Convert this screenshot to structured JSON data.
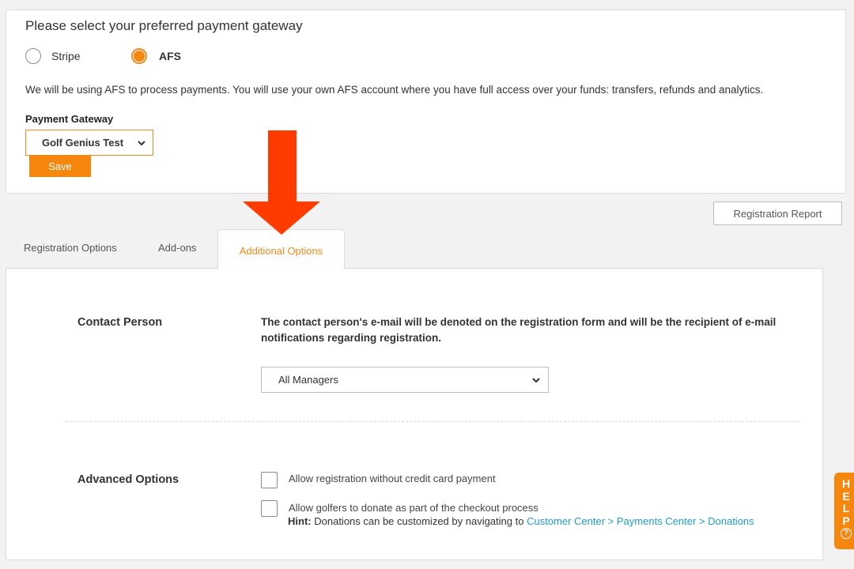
{
  "payment": {
    "title": "Please select your preferred payment gateway",
    "options": [
      {
        "label": "Stripe",
        "selected": false
      },
      {
        "label": "AFS",
        "selected": true
      }
    ],
    "description": "We will be using AFS to process payments. You will use your own AFS account where you have full access over your funds: transfers, refunds and analytics.",
    "gateway_label": "Payment Gateway",
    "gateway_value": "Golf Genius Test",
    "save_label": "Save"
  },
  "toolbar": {
    "registration_report": "Registration Report"
  },
  "tabs": [
    {
      "label": "Registration Options",
      "active": false
    },
    {
      "label": "Add-ons",
      "active": false
    },
    {
      "label": "Additional Options",
      "active": true
    }
  ],
  "contact": {
    "label": "Contact Person",
    "description": "The contact person's e-mail will be denoted on the registration form and will be the recipient of e-mail notifications regarding registration.",
    "select_value": "All Managers"
  },
  "advanced": {
    "label": "Advanced Options",
    "options": [
      {
        "label": "Allow registration without credit card payment",
        "checked": false
      },
      {
        "label": "Allow golfers to donate as part of the checkout process",
        "checked": false
      }
    ],
    "hint_prefix": "Hint:",
    "hint_text": "Donations can be customized by navigating to",
    "hint_link": "Customer Center > Payments Center > Donations"
  },
  "help": {
    "letters": [
      "H",
      "E",
      "L",
      "P"
    ],
    "icon": "question-circle-icon"
  },
  "colors": {
    "accent": "#f5870f",
    "arrow": "#ff3b00",
    "link": "#1f9bc8"
  }
}
